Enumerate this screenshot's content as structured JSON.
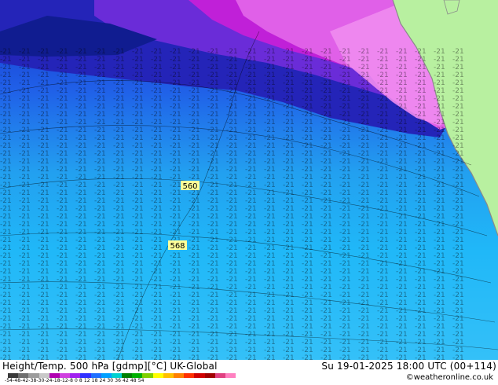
{
  "header": {
    "title_left": "Height/Temp. 500 hPa [gdmp][°C] UK-Global",
    "title_right": "Su 19-01-2025 18:00 UTC (00+114)",
    "credit": "©weatheronline.co.uk"
  },
  "colorbar": {
    "labels": "-54-48-42-38-30-24-18-12-8  0  8  12 18 24 30 36 42 48 54",
    "colors": [
      "#3a3a3a",
      "#6e6e6e",
      "#9c9c9c",
      "#c8c8c8",
      "#b000b0",
      "#d040e0",
      "#a020f0",
      "#3030ff",
      "#2070ff",
      "#00a0ff",
      "#00d0d0",
      "#008000",
      "#00b000",
      "#80d000",
      "#ffff00",
      "#ffc000",
      "#ff8000",
      "#ff3000",
      "#d00000",
      "#a00000",
      "#e04080",
      "#ff80c0"
    ]
  },
  "map": {
    "contour_labels": [
      "560",
      "568"
    ],
    "colors": {
      "land": "#b8f0a0",
      "coast": "#9a9a9a",
      "labels": "#000000",
      "contour_label_bg": "#ffff99"
    }
  }
}
